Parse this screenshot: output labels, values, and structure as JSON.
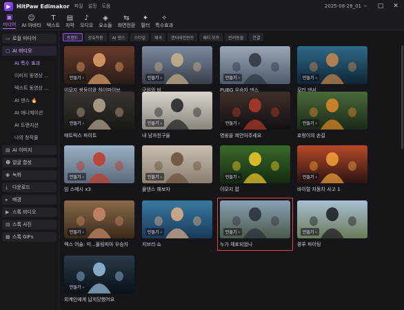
{
  "app": {
    "title": "HitPaw Edimakor",
    "date": "2025-08-28_01"
  },
  "menu": [
    "파일",
    "설정",
    "도움"
  ],
  "toolbar": [
    {
      "label": "미디어",
      "icon": "media-icon",
      "glyph": "▣",
      "active": true
    },
    {
      "label": "AI 아바타",
      "icon": "avatar-icon",
      "glyph": "☺"
    },
    {
      "label": "텍스트",
      "icon": "text-icon",
      "glyph": "T"
    },
    {
      "label": "자막",
      "icon": "subtitle-icon",
      "glyph": "▤"
    },
    {
      "label": "오디오",
      "icon": "audio-icon",
      "glyph": "♪"
    },
    {
      "label": "요소들",
      "icon": "elements-icon",
      "glyph": "◈"
    },
    {
      "label": "화면전환",
      "icon": "transition-icon",
      "glyph": "⇆"
    },
    {
      "label": "필터",
      "icon": "filter-icon",
      "glyph": "✦"
    },
    {
      "label": "특수효과",
      "icon": "effects-icon",
      "glyph": "✧"
    }
  ],
  "sidebar": {
    "local_media": "로컬 미디어",
    "ai_video": "AI 비디오",
    "ai_video_sub": [
      "AI 특수 효과",
      "이미지 동영상 ...",
      "텍스트 동영상 ...",
      "AI 댄스",
      "AI 애니메이션",
      "AI 트랜지션",
      "나의 창작물"
    ],
    "fire_glyph": "🔥",
    "ai_image": "AI 이미지",
    "face_change": "얼굴 합성",
    "record": "녹화",
    "download": "다운로드",
    "background": "배경",
    "stock_video": "스톡 비디오",
    "stock_photo": "스톡 사진",
    "stock_gifs": "스톡 GIFs"
  },
  "categories": [
    "트렌드",
    "상호작용",
    "AI 댄스",
    "스타일",
    "왜곡",
    "엔터테인먼트",
    "페티 모프",
    "반려동물",
    "연결"
  ],
  "make_label": "만들기 ›",
  "cards": [
    {
      "title": "이모지 쌍둥이와 하이파이브",
      "c1": "#6a3a2a",
      "c2": "#2a1d18",
      "accent": "#e2a36b"
    },
    {
      "title": "구원의 비",
      "c1": "#7a8aa0",
      "c2": "#3b3f4a",
      "accent": "#c9b48a"
    },
    {
      "title": "PUBG 우승자 댄스",
      "c1": "#9aa6b5",
      "c2": "#4d5a6a",
      "accent": "#2d3440"
    },
    {
      "title": "모터 댄서",
      "c1": "#2f6a8a",
      "c2": "#0f2535",
      "accent": "#c9874d"
    },
    {
      "title": "매트릭스 파이트",
      "c1": "#3a3530",
      "c2": "#1a1815",
      "accent": "#bba890"
    },
    {
      "title": "내 남자친구들",
      "c1": "#d8d4cc",
      "c2": "#8a857c",
      "accent": "#1e1e24"
    },
    {
      "title": "영웅을 껴안아주세요",
      "c1": "#3e2f28",
      "c2": "#141014",
      "accent": "#b23a2a"
    },
    {
      "title": "호랑이의 손길",
      "c1": "#4a6a3a",
      "c2": "#1c2a18",
      "accent": "#e08a2a"
    },
    {
      "title": "임 스매시 x3",
      "c1": "#9ab0c4",
      "c2": "#5a6a7a",
      "accent": "#c23a2a"
    },
    {
      "title": "물댄스 해보자",
      "c1": "#c8bfb0",
      "c2": "#8a7f70",
      "accent": "#6a4e3a"
    },
    {
      "title": "이모지 팝",
      "c1": "#3a6a2a",
      "c2": "#142a10",
      "accent": "#f2cc2a"
    },
    {
      "title": "바이럴 자동차 사고 1",
      "c1": "#b84a2a",
      "c2": "#2a1410",
      "accent": "#f2a23a"
    },
    {
      "title": "렉스 어술: 미...물림피아 우승자",
      "c1": "#8a6a4a",
      "c2": "#3a2a1a",
      "accent": "#c98a6a"
    },
    {
      "title": "지브리 쇼",
      "c1": "#3a7aa0",
      "c2": "#1a3a5a",
      "accent": "#e0b08a"
    },
    {
      "title": "누가 체포되었나",
      "c1": "#8aa0b4",
      "c2": "#4a5a4a",
      "accent": "#2a2e3a",
      "selected": true
    },
    {
      "title": "콩푸 파이팅",
      "c1": "#a8c0d0",
      "c2": "#6a7a5a",
      "accent": "#1a1a1e"
    },
    {
      "title": "외계인에게 납치당했어요",
      "c1": "#2a3a4a",
      "c2": "#0a1218",
      "accent": "#9ac0e0"
    }
  ]
}
